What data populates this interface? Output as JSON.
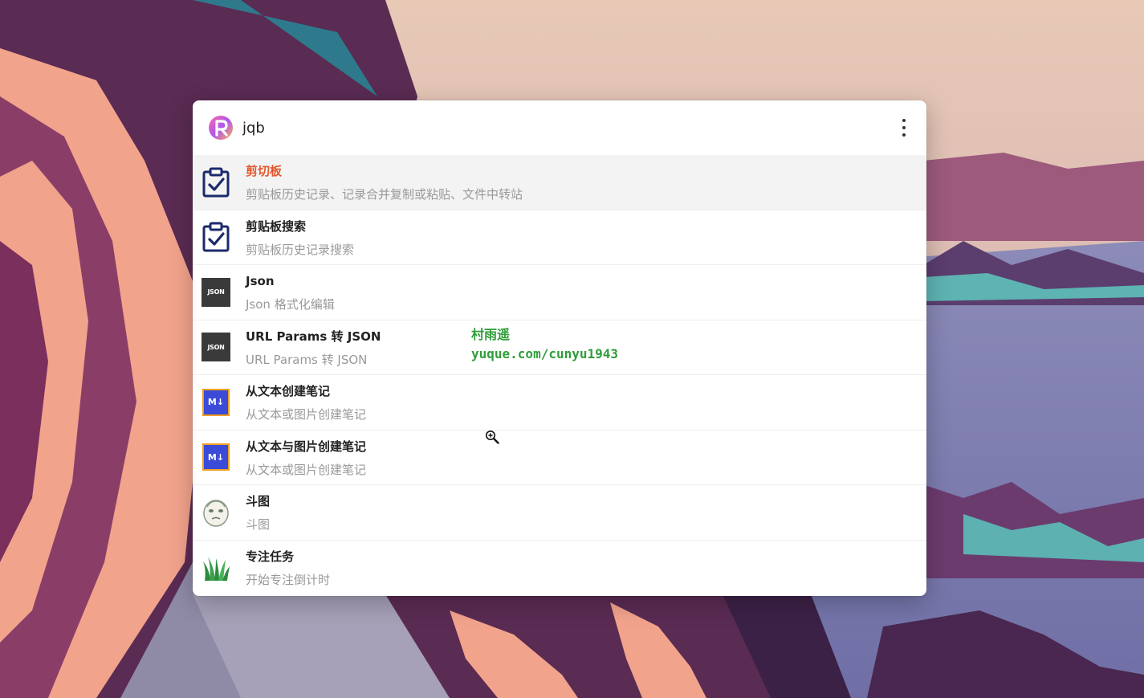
{
  "search": {
    "value": "jqb"
  },
  "results": [
    {
      "title": "剪切板",
      "description": "剪贴板历史记录、记录合并复制或粘贴、文件中转站",
      "icon": "clipboard-check-icon",
      "selected": true
    },
    {
      "title": "剪贴板搜索",
      "description": "剪贴板历史记录搜索",
      "icon": "clipboard-check-icon",
      "selected": false
    },
    {
      "title": "Json",
      "description": "Json 格式化编辑",
      "icon": "json-icon",
      "icon_text": "JSON",
      "selected": false
    },
    {
      "title": "URL Params 转 JSON",
      "description": "URL Params 转 JSON",
      "icon": "json-icon",
      "icon_text": "JSON",
      "selected": false
    },
    {
      "title": "从文本创建笔记",
      "description": "从文本或图片创建笔记",
      "icon": "markdown-icon",
      "icon_text": "M↓",
      "selected": false
    },
    {
      "title": "从文本与图片创建笔记",
      "description": "从文本或图片创建笔记",
      "icon": "markdown-icon",
      "icon_text": "M↓",
      "selected": false
    },
    {
      "title": "斗图",
      "description": "斗图",
      "icon": "meme-face-icon",
      "selected": false
    },
    {
      "title": "专注任务",
      "description": "开始专注倒计时",
      "icon": "grass-icon",
      "selected": false
    }
  ],
  "watermark": {
    "line1": "村雨遥",
    "line2": "yuque.com/cunyu1943"
  },
  "colors": {
    "selected_title": "#e4572e",
    "watermark": "#2f9d3a"
  }
}
